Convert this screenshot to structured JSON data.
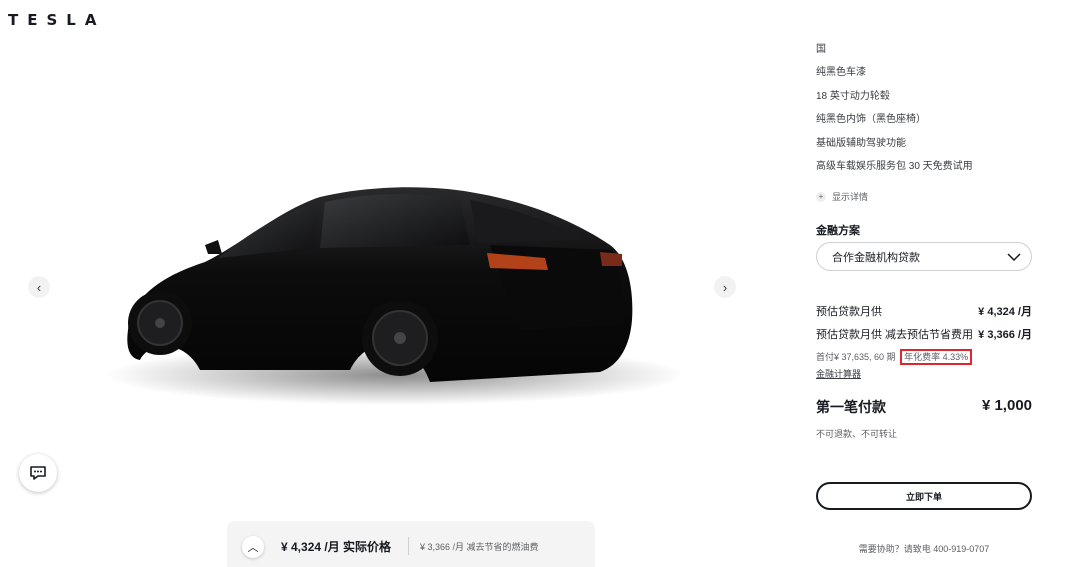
{
  "brand": {
    "logo_text": "TESLA"
  },
  "specs": [
    "国",
    "纯黑色车漆",
    "18 英寸动力轮毂",
    "纯黑色内饰（黑色座椅）",
    "基础版辅助驾驶功能",
    "高级车载娱乐服务包 30 天免费试用"
  ],
  "show_details_label": "显示详情",
  "financing": {
    "title": "金融方案",
    "selected_option": "合作金融机构贷款",
    "monthly_label": "预估贷款月供",
    "monthly_value": "¥ 4,324 /月",
    "monthly_savings_label": "预估贷款月供 减去预估节省费用",
    "monthly_savings_value": "¥ 3,366 /月",
    "terms_text": "首付¥ 37,635, 60 期",
    "rate_text": "年化费率 4.33%",
    "calculator_link": "金融计算器"
  },
  "first_payment": {
    "label": "第一笔付款",
    "amount": "¥ 1,000",
    "note": "不可退款、不可转让"
  },
  "order_button": "立即下单",
  "help_text": "需要协助？请致电 400-919-0707",
  "summary_bar": {
    "price": "¥ 4,324 /月 实际价格",
    "alt": "¥ 3,366 /月 减去节省的燃油费"
  },
  "colors": {
    "text": "#171a20",
    "highlight_box": "#e0262c",
    "car_body": "#111111"
  }
}
